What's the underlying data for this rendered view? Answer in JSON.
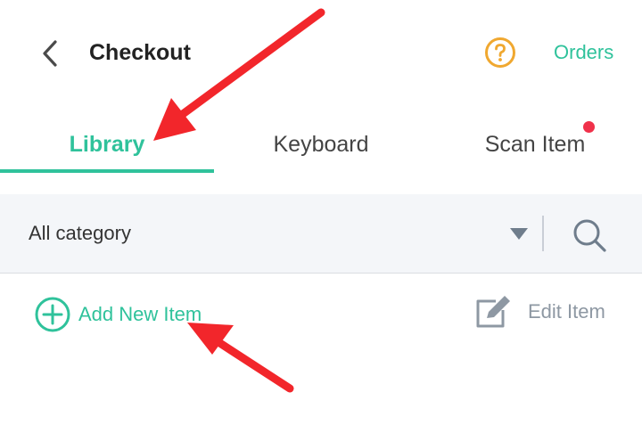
{
  "header": {
    "back_icon": "chevron-left-icon",
    "title": "Checkout",
    "help_icon": "question-circle-icon",
    "orders_label": "Orders"
  },
  "tabs": [
    {
      "label": "Library",
      "active": true
    },
    {
      "label": "Keyboard",
      "active": false
    },
    {
      "label": "Scan Item",
      "active": false,
      "has_badge": true
    }
  ],
  "filter": {
    "category_label": "All category",
    "dropdown_icon": "caret-down-icon",
    "search_icon": "search-icon"
  },
  "actions": {
    "add_icon": "plus-circle-icon",
    "add_label": "Add New Item",
    "edit_icon": "edit-icon",
    "edit_label": "Edit Item"
  },
  "colors": {
    "accent": "#2fc29b",
    "help_icon": "#f0a830",
    "badge": "#f0314a",
    "annotation_arrow": "#f2262b",
    "filter_bg": "#f4f6f9",
    "muted_text": "#8e98a3"
  }
}
